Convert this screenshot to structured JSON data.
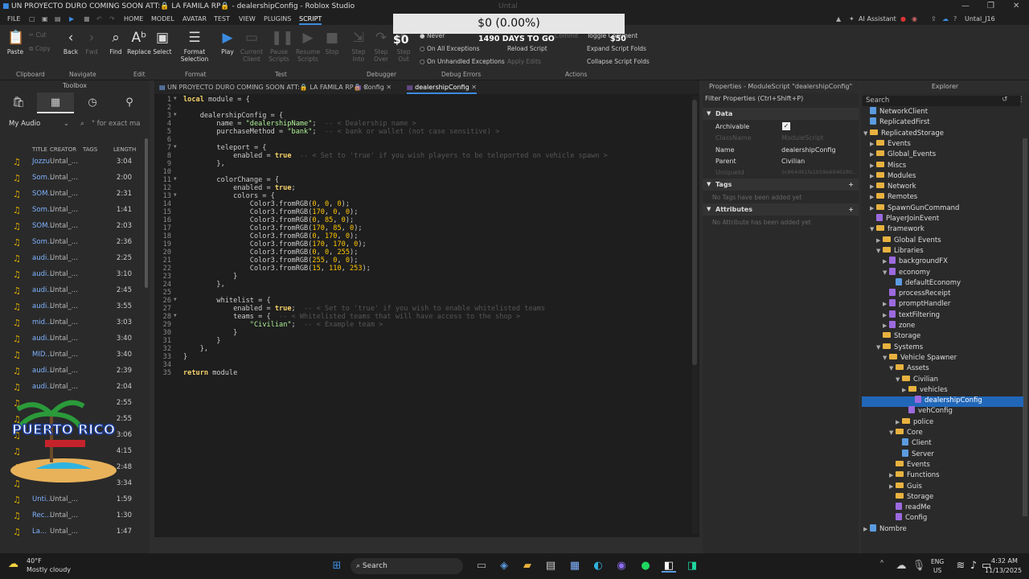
{
  "titlebar": {
    "title": "UN PROYECTO DURO COMING SOON ATT:🔒 LA FAMILA RP🔒 - dealershipConfig - Roblox Studio",
    "sub": "Untal"
  },
  "menu": {
    "file": "FILE",
    "items": [
      "HOME",
      "MODEL",
      "AVATAR",
      "TEST",
      "VIEW",
      "PLUGINS",
      "SCRIPT"
    ],
    "ai": "AI Assistant",
    "user": "Untal_J16"
  },
  "overlay": {
    "money": "$0 (0.00%)",
    "days": "1490 DAYS TO GO",
    "left": "$0",
    "right": "$50"
  },
  "ribbon": {
    "paste": "Paste",
    "cut": "Cut",
    "copy": "Copy",
    "back": "Back",
    "fwd": "Fwd",
    "find": "Find",
    "replace": "Replace",
    "select": "Select",
    "format": "Format Selection",
    "play": "Play",
    "current_client": "Current Client",
    "pause": "Pause Scripts",
    "resume": "Resume Scripts",
    "stop": "Stop",
    "step_into": "Step Into",
    "step_over": "Step Over",
    "step_out": "Step Out",
    "never": "Never",
    "all_exc": "On All Exceptions",
    "unhandled": "On Unhandled Exceptions",
    "reload": "Reload Script",
    "apply": "Apply Edits",
    "commit": "Commit",
    "toggle": "Toggle Comment",
    "expand": "Expand Script Folds",
    "collapse": "Collapse Script Folds",
    "groups": [
      "Clipboard",
      "Navigate",
      "Edit",
      "Format",
      "Test",
      "Debugger",
      "Debug Errors",
      "Actions"
    ]
  },
  "toolbox": {
    "title": "Toolbox",
    "filter": "My Audio",
    "search": "\" for exact ma",
    "cols": [
      "TITLE",
      "CREATOR",
      "TAGS",
      "LENGTH"
    ],
    "rows": [
      [
        "Jozzu",
        "Untal_...",
        "3:04"
      ],
      [
        "Som...",
        "Untal_...",
        "2:00"
      ],
      [
        "SOM...",
        "Untal_...",
        "2:31"
      ],
      [
        "Som...",
        "Untal_...",
        "1:41"
      ],
      [
        "SOM...",
        "Untal_...",
        "2:03"
      ],
      [
        "Som...",
        "Untal_...",
        "2:36"
      ],
      [
        "audi...",
        "Untal_...",
        "2:25"
      ],
      [
        "audi...",
        "Untal_...",
        "3:10"
      ],
      [
        "audi...",
        "Untal_...",
        "2:45"
      ],
      [
        "audi...",
        "Untal_...",
        "3:55"
      ],
      [
        "mid...",
        "Untal_...",
        "3:03"
      ],
      [
        "audi...",
        "Untal_...",
        "3:40"
      ],
      [
        "MID...",
        "Untal_...",
        "3:40"
      ],
      [
        "audi...",
        "Untal_...",
        "2:39"
      ],
      [
        "audi...",
        "Untal_...",
        "2:04"
      ],
      [
        "",
        "",
        "2:55"
      ],
      [
        "",
        "",
        "2:55"
      ],
      [
        "",
        "",
        "3:06"
      ],
      [
        "",
        "",
        "4:15"
      ],
      [
        "",
        "",
        "2:48"
      ],
      [
        "",
        "",
        "3:34"
      ],
      [
        "Unti...",
        "Untal_...",
        "1:59"
      ],
      [
        "Rec...",
        "Untal_...",
        "1:30"
      ],
      [
        "La...",
        "Untal_...",
        "1:47"
      ]
    ],
    "logo": "PUERTO RICO"
  },
  "tabs": [
    "UN PROYECTO DURO COMING SOON ATT:🔒 LA FAMILA RP🔒",
    "Config",
    "dealershipConfig"
  ],
  "code": [
    "local module = {",
    "",
    "\tdealershipConfig = {",
    "\t\tname = \"dealershipName\";  -- < Dealership name >",
    "\t\tpurchaseMethod = \"bank\";  -- < bank or wallet (not case sensitive) >",
    "",
    "\t\tteleport = {",
    "\t\t\tenabled = true  -- < Set to 'true' if you wish players to be teleported on vehicle spawn >",
    "\t\t},",
    "",
    "\t\tcolorChange = {",
    "\t\t\tenabled = true;",
    "\t\t\tcolors = {",
    "\t\t\t\tColor3.fromRGB(0, 0, 0);",
    "\t\t\t\tColor3.fromRGB(170, 0, 0);",
    "\t\t\t\tColor3.fromRGB(0, 85, 0);",
    "\t\t\t\tColor3.fromRGB(170, 85, 0);",
    "\t\t\t\tColor3.fromRGB(0, 170, 0);",
    "\t\t\t\tColor3.fromRGB(170, 170, 0);",
    "\t\t\t\tColor3.fromRGB(0, 0, 255);",
    "\t\t\t\tColor3.fromRGB(255, 0, 0);",
    "\t\t\t\tColor3.fromRGB(15, 110, 253);",
    "\t\t\t}",
    "\t\t},",
    "",
    "\t\twhitelist = {",
    "\t\t\tenabled = true;  -- < Set to 'true' if you wish to enable whitelisted teams",
    "\t\t\tteams = {  -- < Whitelisted teams that will have access to the shop >",
    "\t\t\t\t\"Civilian\";  -- < Example team >",
    "\t\t\t}",
    "\t\t}",
    "\t},",
    "}",
    "",
    "return module"
  ],
  "properties": {
    "title": "Properties - ModuleScript \"dealershipConfig\"",
    "filter": "Filter Properties (Ctrl+Shift+P)",
    "data": "Data",
    "rows": [
      [
        "Archivable",
        ""
      ],
      [
        "ClassName",
        "ModuleScript"
      ],
      [
        "Name",
        "dealershipConfig"
      ],
      [
        "Parent",
        "Civilian"
      ],
      [
        "UniqueId",
        "5c864d61fe1b59e6946280..."
      ]
    ],
    "tags": "Tags",
    "no_tags": "No Tags have been added yet",
    "attributes": "Attributes",
    "no_attr": "No Attribute has been added yet"
  },
  "explorer": {
    "title": "Explorer",
    "search": "Search",
    "items": [
      "NetworkClient",
      "ReplicatedFirst",
      "ReplicatedStorage",
      "Events",
      "Global_Events",
      "Miscs",
      "Modules",
      "Network",
      "Remotes",
      "SpawnGunCommand",
      "PlayerJoinEvent",
      "framework",
      "Global Events",
      "Libraries",
      "backgroundFX",
      "economy",
      "defaultEconomy",
      "processReceipt",
      "promptHandler",
      "textFiltering",
      "zone",
      "Storage",
      "Systems",
      "Vehicle Spawner",
      "Assets",
      "Civilian",
      "vehicles",
      "dealershipConfig",
      "vehConfig",
      "police",
      "Core",
      "Client",
      "Server",
      "Events",
      "Functions",
      "Guis",
      "Storage",
      "readMe",
      "Config",
      "Nombre"
    ]
  },
  "taskbar": {
    "temp": "40°F",
    "weather": "Mostly cloudy",
    "search": "Search",
    "lang1": "ENG",
    "lang2": "US",
    "time": "4:32 AM",
    "date": "11/13/2025"
  }
}
